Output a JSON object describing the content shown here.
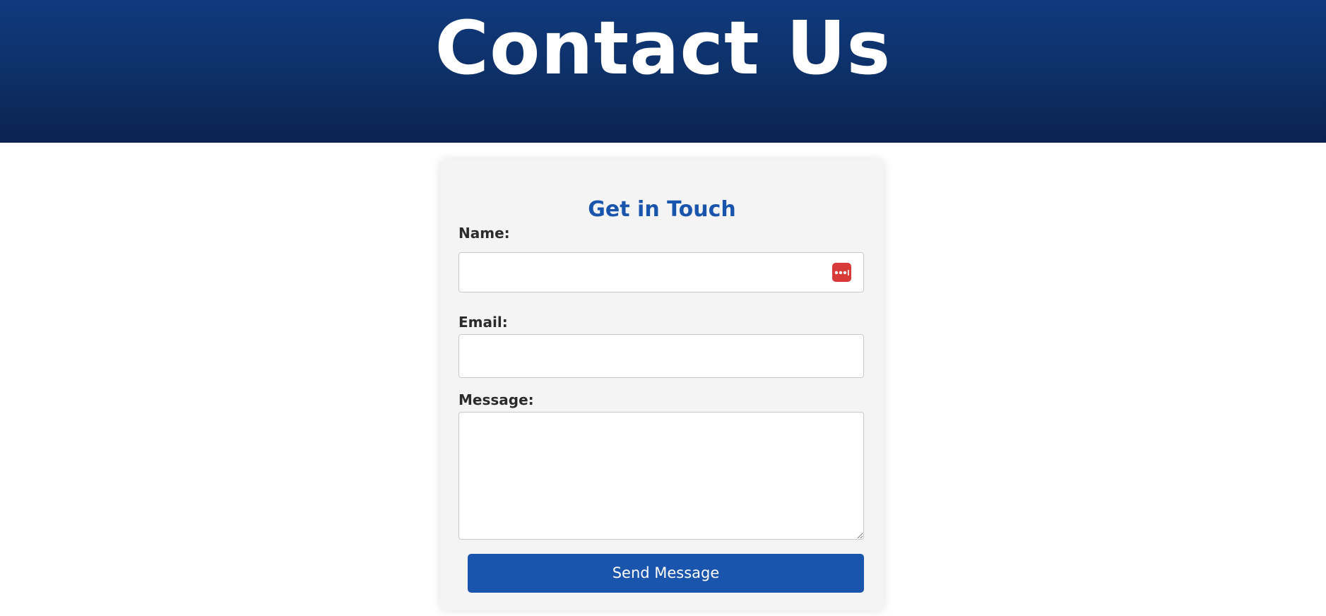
{
  "hero": {
    "title": "Contact Us"
  },
  "form": {
    "title": "Get in Touch",
    "fields": {
      "name": {
        "label": "Name:",
        "value": "",
        "placeholder": ""
      },
      "email": {
        "label": "Email:",
        "value": "",
        "placeholder": ""
      },
      "message": {
        "label": "Message:",
        "value": "",
        "placeholder": ""
      }
    },
    "submit_label": "Send Message"
  },
  "icons": {
    "password_manager": "password-manager-icon"
  },
  "colors": {
    "hero_top": "#103a7e",
    "hero_bottom": "#0a2250",
    "accent": "#1a55ad",
    "badge": "#d83a3a",
    "card_bg": "#f4f4f4"
  }
}
